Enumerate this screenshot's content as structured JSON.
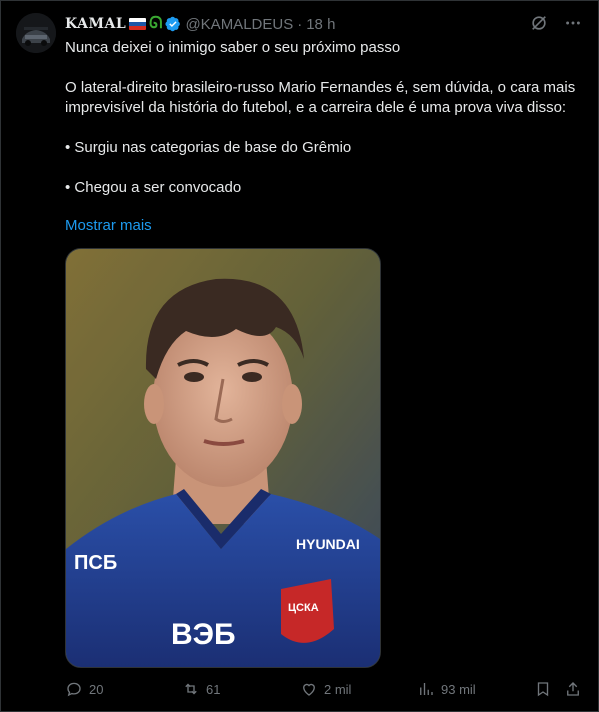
{
  "tweet": {
    "author": {
      "display_name": "KAMAL",
      "emoji_flag": "russia-flag",
      "emoji_extra": "ᘏ",
      "verified": true,
      "handle": "@KAMALDEUS",
      "separator": "·",
      "time": "18 h"
    },
    "text": {
      "line1": "Nunca deixei o inimigo saber o seu próximo passo",
      "para2": "O lateral-direito brasileiro-russo Mario Fernandes é, sem dúvida, o cara mais imprevisível da história do futebol, e a carreira dele é uma prova viva disso:",
      "bullet1": "• Surgiu nas categorias de base do Grêmio",
      "bullet2": "• Chegou a ser convocado"
    },
    "show_more": "Mostrar mais",
    "actions": {
      "replies": "20",
      "reposts": "61",
      "likes": "2 mil",
      "views": "93 mil"
    },
    "colors": {
      "background": "#000000",
      "text": "#e7e9ea",
      "secondary": "#71767b",
      "link": "#1d9bf0",
      "verified": "#1d9bf0",
      "repost_accent": "#00ba7c"
    }
  }
}
